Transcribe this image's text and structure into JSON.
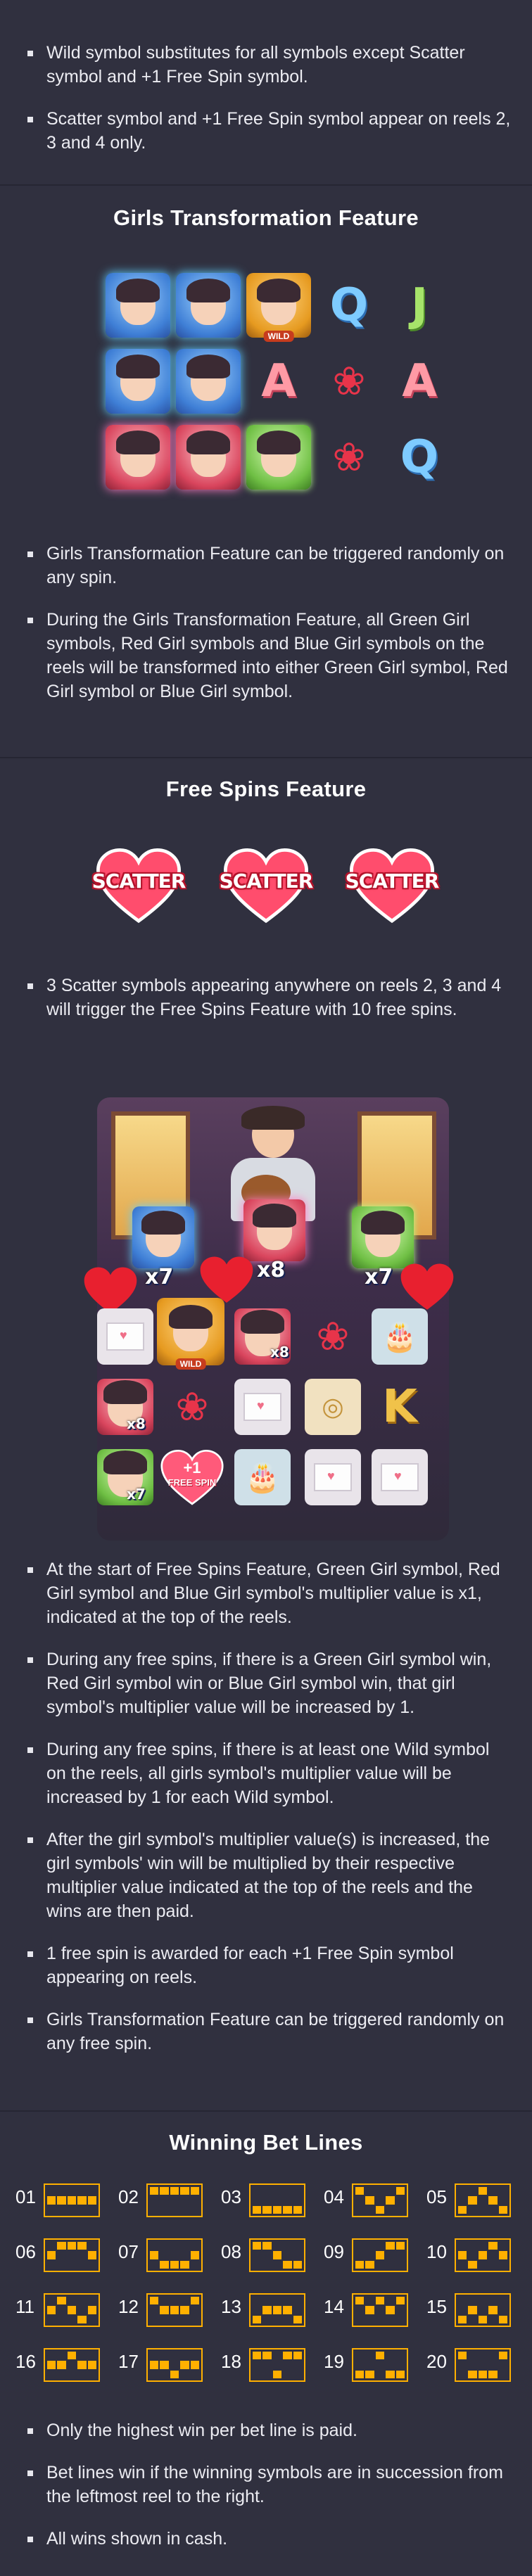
{
  "intro_bullets": [
    "Wild symbol substitutes for all symbols except Scatter symbol and +1 Free Spin symbol.",
    "Scatter symbol and +1 Free Spin symbol appear on reels 2, 3 and 4 only."
  ],
  "transformation": {
    "title": "Girls Transformation Feature",
    "wild_tag": "WILD",
    "grid": [
      [
        "girl-blue",
        "girl-blue",
        "wild",
        "Q",
        "J"
      ],
      [
        "girl-blue",
        "girl-blue",
        "A",
        "rose",
        "A"
      ],
      [
        "girl-red",
        "girl-red",
        "girl-green",
        "rose",
        "Q"
      ]
    ],
    "bullets": [
      "Girls Transformation Feature can be triggered randomly on any spin.",
      "During the Girls Transformation Feature, all Green Girl symbols, Red Girl symbols and Blue Girl symbols on the reels will be transformed into either Green Girl symbol, Red Girl symbol or Blue Girl symbol."
    ]
  },
  "free_spins": {
    "title": "Free Spins Feature",
    "scatter_label": "SCATTER",
    "scatter_count": 3,
    "bullets_top": [
      "3 Scatter symbols appearing anywhere on reels 2, 3 and 4 will trigger the Free Spins Feature with 10 free spins."
    ],
    "scene": {
      "multipliers": [
        "x7",
        "x8",
        "x7"
      ],
      "cell_tags": [
        "x8",
        "x8",
        "x7"
      ],
      "free_spin_badge": "+1",
      "free_spin_text": "FREE SPIN",
      "wild_tag": "WILD"
    },
    "bullets": [
      "At the start of Free Spins Feature, Green Girl symbol, Red Girl symbol and Blue Girl symbol's multiplier value is x1, indicated at the top of the reels.",
      "During any free spins, if there is a Green Girl symbol win, Red Girl symbol win or Blue Girl symbol win, that girl symbol's multiplier value will be increased by 1.",
      "During any free spins, if there is at least one Wild symbol on the reels, all girls symbol's multiplier value will be increased by 1 for each Wild symbol.",
      "After the girl symbol's multiplier value(s) is increased, the girl symbols' win will be multiplied by their respective multiplier value indicated at the top of the reels and the wins are then paid.",
      "1 free spin is awarded for each +1 Free Spin symbol appearing on reels.",
      "Girls Transformation Feature can be triggered randomly on any free spin."
    ]
  },
  "bet_lines": {
    "title": "Winning Bet Lines",
    "lines": [
      {
        "num": "01",
        "rows": [
          1,
          1,
          1,
          1,
          1
        ]
      },
      {
        "num": "02",
        "rows": [
          0,
          0,
          0,
          0,
          0
        ]
      },
      {
        "num": "03",
        "rows": [
          2,
          2,
          2,
          2,
          2
        ]
      },
      {
        "num": "04",
        "rows": [
          0,
          1,
          2,
          1,
          0
        ]
      },
      {
        "num": "05",
        "rows": [
          2,
          1,
          0,
          1,
          2
        ]
      },
      {
        "num": "06",
        "rows": [
          1,
          0,
          0,
          0,
          1
        ]
      },
      {
        "num": "07",
        "rows": [
          1,
          2,
          2,
          2,
          1
        ]
      },
      {
        "num": "08",
        "rows": [
          0,
          0,
          1,
          2,
          2
        ]
      },
      {
        "num": "09",
        "rows": [
          2,
          2,
          1,
          0,
          0
        ]
      },
      {
        "num": "10",
        "rows": [
          1,
          2,
          1,
          0,
          1
        ]
      },
      {
        "num": "11",
        "rows": [
          1,
          0,
          1,
          2,
          1
        ]
      },
      {
        "num": "12",
        "rows": [
          0,
          1,
          1,
          1,
          0
        ]
      },
      {
        "num": "13",
        "rows": [
          2,
          1,
          1,
          1,
          2
        ]
      },
      {
        "num": "14",
        "rows": [
          0,
          1,
          0,
          1,
          0
        ]
      },
      {
        "num": "15",
        "rows": [
          2,
          1,
          2,
          1,
          2
        ]
      },
      {
        "num": "16",
        "rows": [
          1,
          1,
          0,
          1,
          1
        ]
      },
      {
        "num": "17",
        "rows": [
          1,
          1,
          2,
          1,
          1
        ]
      },
      {
        "num": "18",
        "rows": [
          0,
          0,
          2,
          0,
          0
        ]
      },
      {
        "num": "19",
        "rows": [
          2,
          2,
          0,
          2,
          2
        ]
      },
      {
        "num": "20",
        "rows": [
          0,
          2,
          2,
          2,
          0
        ]
      }
    ],
    "bullets": [
      "Only the highest win per bet line is paid.",
      "Bet lines win if the winning symbols are in succession from the leftmost reel to the right.",
      "All wins shown in cash."
    ]
  },
  "colors": {
    "background": "#30303f",
    "divider": "#262633",
    "line_accent": "#ffb000"
  }
}
